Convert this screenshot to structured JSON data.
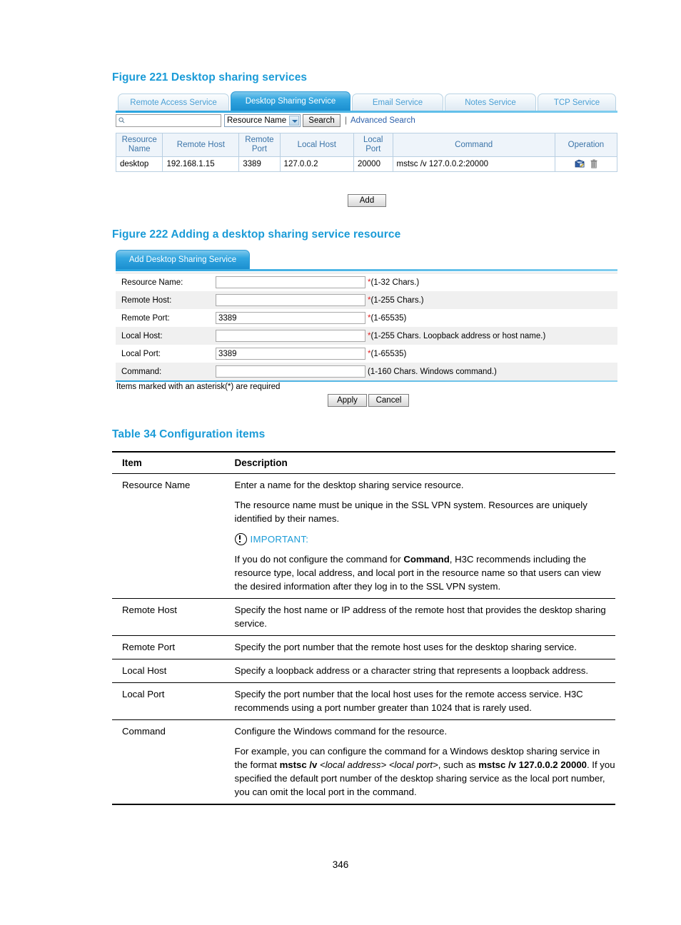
{
  "figure221": {
    "caption": "Figure 221 Desktop sharing services",
    "tabs": [
      {
        "label": "Remote Access Service",
        "active": false
      },
      {
        "label": "Desktop Sharing Service",
        "active": true
      },
      {
        "label": "Email Service",
        "active": false
      },
      {
        "label": "Notes Service",
        "active": false
      },
      {
        "label": "TCP Service",
        "active": false
      }
    ],
    "search": {
      "icon": "search-icon",
      "value": "",
      "placeholder": "",
      "select_value": "Resource Name",
      "select_options": [
        "Resource Name"
      ],
      "search_button": "Search",
      "separator": "|",
      "advanced_link": "Advanced Search"
    },
    "table": {
      "headers": [
        "Resource Name",
        "Remote Host",
        "Remote Port",
        "Local Host",
        "Local Port",
        "Command",
        "Operation"
      ],
      "rows": [
        {
          "resource_name": "desktop",
          "remote_host": "192.168.1.15",
          "remote_port": "3389",
          "local_host": "127.0.0.2",
          "local_port": "20000",
          "command": "mstsc /v 127.0.0.2:20000",
          "operations": [
            "edit-icon",
            "delete-icon"
          ]
        }
      ]
    },
    "add_button": "Add"
  },
  "figure222": {
    "caption": "Figure 222 Adding a desktop sharing service resource",
    "panel_tab": "Add Desktop Sharing Service",
    "fields": [
      {
        "label": "Resource Name:",
        "value": "",
        "required": true,
        "hint": "(1-32 Chars.)"
      },
      {
        "label": "Remote Host:",
        "value": "",
        "required": true,
        "hint": "(1-255 Chars.)"
      },
      {
        "label": "Remote Port:",
        "value": "3389",
        "required": true,
        "hint": "(1-65535)"
      },
      {
        "label": "Local Host:",
        "value": "",
        "required": true,
        "hint": "(1-255 Chars. Loopback address or host name.)"
      },
      {
        "label": "Local Port:",
        "value": "3389",
        "required": true,
        "hint": "(1-65535)"
      },
      {
        "label": "Command:",
        "value": "",
        "required": false,
        "hint": "(1-160 Chars. Windows command.)"
      }
    ],
    "asterisk_note": "Items marked with an asterisk(*) are required",
    "apply_button": "Apply",
    "cancel_button": "Cancel"
  },
  "table34": {
    "caption": "Table 34 Configuration items",
    "headers": [
      "Item",
      "Description"
    ],
    "rows": [
      {
        "item": "Resource Name",
        "paragraphs": [
          "Enter a name for the desktop sharing service resource.",
          "The resource name must be unique in the SSL VPN system. Resources are uniquely identified by their names."
        ],
        "important_label": "IMPORTANT:",
        "important_icon": "exclamation-circle-icon",
        "important_text_pre": "If you do not configure the command for ",
        "important_text_bold": "Command",
        "important_text_post": ", H3C recommends including the resource type, local address, and local port in the resource name so that users can view the desired information after they log in to the SSL VPN system."
      },
      {
        "item": "Remote Host",
        "paragraphs": [
          "Specify the host name or IP address of the remote host that provides the desktop sharing service."
        ]
      },
      {
        "item": "Remote Port",
        "paragraphs": [
          "Specify the port number that the remote host uses for the desktop sharing service."
        ]
      },
      {
        "item": "Local Host",
        "paragraphs": [
          "Specify a loopback address or a character string that represents a loopback address."
        ]
      },
      {
        "item": "Local Port",
        "paragraphs": [
          "Specify the port number that the local host uses for the remote access service. H3C recommends using a port number greater than 1024 that is rarely used."
        ]
      },
      {
        "item": "Command",
        "paragraphs": [
          "Configure the Windows command for the resource."
        ],
        "example_pre": "For example, you can configure the command for a Windows desktop sharing service in the format ",
        "example_cmd_bold": "mstsc /v",
        "example_arg1": "<local address>",
        "example_arg2": "<local port>",
        "example_mid": ", such as ",
        "example_cmd2_bold": "mstsc /v 127.0.0.2 20000",
        "example_post": ". If you specified the default port number of the desktop sharing service as the local port number, you can omit the local port in the command."
      }
    ]
  },
  "page_number": "346",
  "colors": {
    "caption_blue": "#1A9BD7",
    "tab_active": "#1b8fd0",
    "link_blue": "#2b5faa",
    "required_red": "#e02020"
  }
}
